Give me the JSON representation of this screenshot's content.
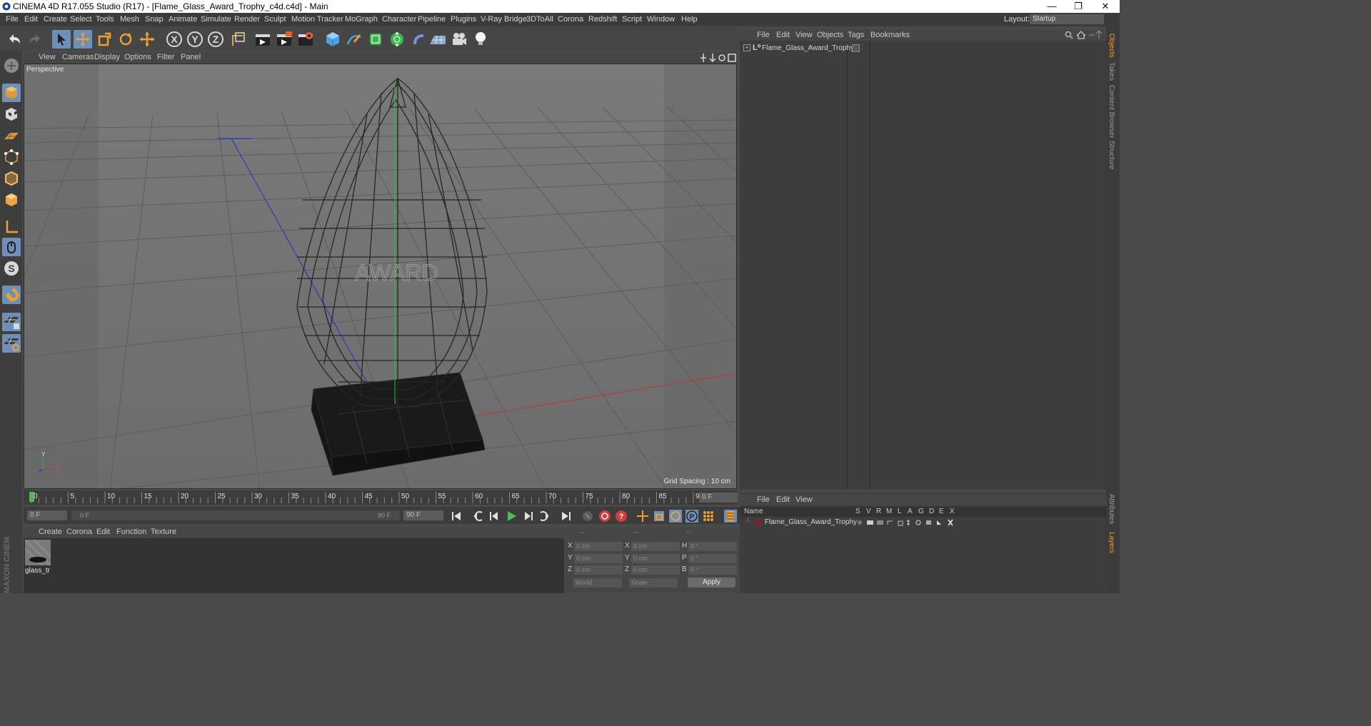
{
  "window": {
    "title": "CINEMA 4D R17.055 Studio (R17) - [Flame_Glass_Award_Trophy_c4d.c4d] - Main",
    "minimize": "—",
    "restore": "❐",
    "close": "✕"
  },
  "menubar": {
    "items": [
      "File",
      "Edit",
      "Create",
      "Select",
      "Tools",
      "Mesh",
      "Snap",
      "Animate",
      "Simulate",
      "Render",
      "Sculpt",
      "Motion Tracker",
      "MoGraph",
      "Character",
      "Pipeline",
      "Plugins",
      "V-Ray Bridge",
      "3DToAll",
      "Corona",
      "Redshift",
      "Script",
      "Window",
      "Help"
    ],
    "layout_label": "Layout:",
    "layout_value": "Startup"
  },
  "viewport": {
    "menu": [
      "View",
      "Cameras",
      "Display",
      "Options",
      "Filter",
      "Panel"
    ],
    "label": "Perspective",
    "grid_spacing": "Grid Spacing : 10 cm",
    "model_text": "AWARD",
    "axis_y": "Y",
    "axis_x": "X"
  },
  "timeline": {
    "ticks": [
      "0",
      "5",
      "10",
      "15",
      "20",
      "25",
      "30",
      "35",
      "40",
      "45",
      "50",
      "55",
      "60",
      "65",
      "70",
      "75",
      "80",
      "85",
      "90"
    ],
    "current_frame": "0 F",
    "start_frame": "0 F",
    "range_start": "0 F",
    "range_end": "90 F",
    "end_frame": "90 F"
  },
  "material_panel": {
    "menu": [
      "Create",
      "Corona",
      "Edit",
      "Function",
      "Texture"
    ],
    "material_name": "glass_tr"
  },
  "coordinates": {
    "headers": [
      "--",
      "--",
      "--"
    ],
    "rows": [
      {
        "l1": "X",
        "v1": "0 cm",
        "l2": "X",
        "v2": "0 cm",
        "l3": "H",
        "v3": "0 °"
      },
      {
        "l1": "Y",
        "v1": "0 cm",
        "l2": "Y",
        "v2": "0 cm",
        "l3": "P",
        "v3": "0 °"
      },
      {
        "l1": "Z",
        "v1": "0 cm",
        "l2": "Z",
        "v2": "0 cm",
        "l3": "B",
        "v3": "0 °"
      }
    ],
    "world": "World",
    "scale": "Scale",
    "apply": "Apply"
  },
  "object_manager": {
    "menu": [
      "File",
      "Edit",
      "View",
      "Objects",
      "Tags",
      "Bookmarks"
    ],
    "object_name": "Flame_Glass_Award_Trophy"
  },
  "layer_manager": {
    "menu": [
      "File",
      "Edit",
      "View"
    ],
    "col_name": "Name",
    "cols": [
      "S",
      "V",
      "R",
      "M",
      "L",
      "A",
      "G",
      "D",
      "E",
      "X"
    ],
    "layer_name": "Flame_Glass_Award_Trophy"
  },
  "side_tabs": [
    "Objects",
    "Takes",
    "Content Browser",
    "Structure",
    "Attributes",
    "Layers"
  ],
  "brand": "MAXON CINEMA 4D",
  "colors": {
    "accent_selected": "#6d8fb8",
    "layer_color": "#8b1a2e",
    "play_green": "#43c24a",
    "record_red": "#d23c3c"
  }
}
